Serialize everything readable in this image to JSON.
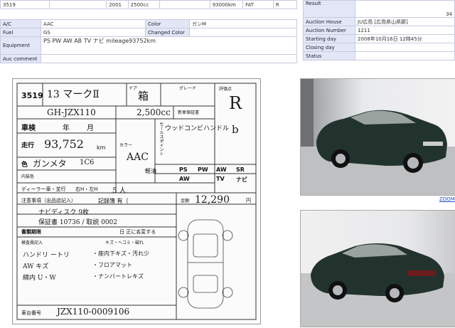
{
  "lot": {
    "lot_no": "3519",
    "year": "2001",
    "displacement": "2500cc",
    "mileage": "93000km",
    "transmission": "FAT",
    "rating": "R"
  },
  "specs": {
    "ac_label": "A/C",
    "ac_value": "AAC",
    "color_label": "Color",
    "color_value": "ガンM",
    "fuel_label": "Fuel",
    "fuel_value": "GS",
    "changed_color_label": "Changed Color",
    "changed_color_value": "",
    "equipment_label": "Equipment",
    "equipment_value": "PS PW AW AB TV ナビ mileage93752km",
    "comment_label": "Auc comment",
    "comment_value": ""
  },
  "auction": {
    "result_label": "Result",
    "result_value": "34",
    "house_label": "Auction House",
    "house_value": "JU広島 [広島県山県郡]",
    "number_label": "Auction Number",
    "number_value": "1211",
    "starting_label": "Starting day",
    "starting_value": "2008年10月16日 12時45分",
    "closing_label": "Closing day",
    "closing_value": "",
    "status_label": "Status",
    "status_value": ""
  },
  "sheet": {
    "lot": "3519",
    "model_hw": "13 マークⅡ",
    "doors_label": "ドア",
    "box_hw": "箱",
    "grade_label": "グレード",
    "score_label": "評価点",
    "score_hw": "R",
    "chassis_hw": "GH-JZX110",
    "cc_hw": "2,500cc",
    "new_cert_label": "新車保証書",
    "shaken_label": "車検",
    "shaken_year": "年",
    "shaken_month": "月",
    "mileage_label": "走行",
    "mileage_hw": "93,752",
    "mileage_unit": "km",
    "color_label": "色",
    "color_hw": "ガンメタ",
    "color_code": "1C6",
    "interior_label": "内装色",
    "color_label2": "カラー",
    "ac_hw": "AAC",
    "fuel_label": "軽油",
    "selling_label": "セールスポイント",
    "selling_hw": "ウッドコンビハンドル",
    "interior_score": "b",
    "equip_ps": "PS",
    "equip_pw": "PW",
    "equip_aw": "AW",
    "equip_sr": "SR",
    "equip_aw2": "AW",
    "equip_tv": "TV",
    "equip_navi": "ナビ",
    "dealer_label": "ディーラー車・並行",
    "steering_label": "右H・左H",
    "seats_hw": "5 人",
    "price_label": "金額",
    "price_hw": "12,290",
    "price_unit": "円",
    "notes_label": "注意事項（出品店記入）",
    "record_label": "記録簿 有（",
    "note1": "ナビディスク 9枚",
    "note2": "保証書 10736 / 取説 0002",
    "spare_label": "書類期限",
    "spare_note": "日 正に名変する",
    "inspector_label": "検査員記入",
    "inspector_header": "キズ・ヘコミ・破れ",
    "ins1": "ハンドリ ートリ",
    "ins2": "AW キズ",
    "ins3": "綿内 U・W",
    "ins4": "・座内下キズ・汚れ少",
    "ins5": "・フロアマット",
    "ins6": "・ナンバートレキズ",
    "plate_label": "車台番号",
    "plate_hw": "JZX110-0009106"
  },
  "photos": {
    "zoom_label": "ZOOM"
  },
  "colors": {
    "label_bg": "#e3e6f7",
    "border": "#c8cbe0",
    "link": "#1a49c9",
    "car_body": "#22332e"
  }
}
